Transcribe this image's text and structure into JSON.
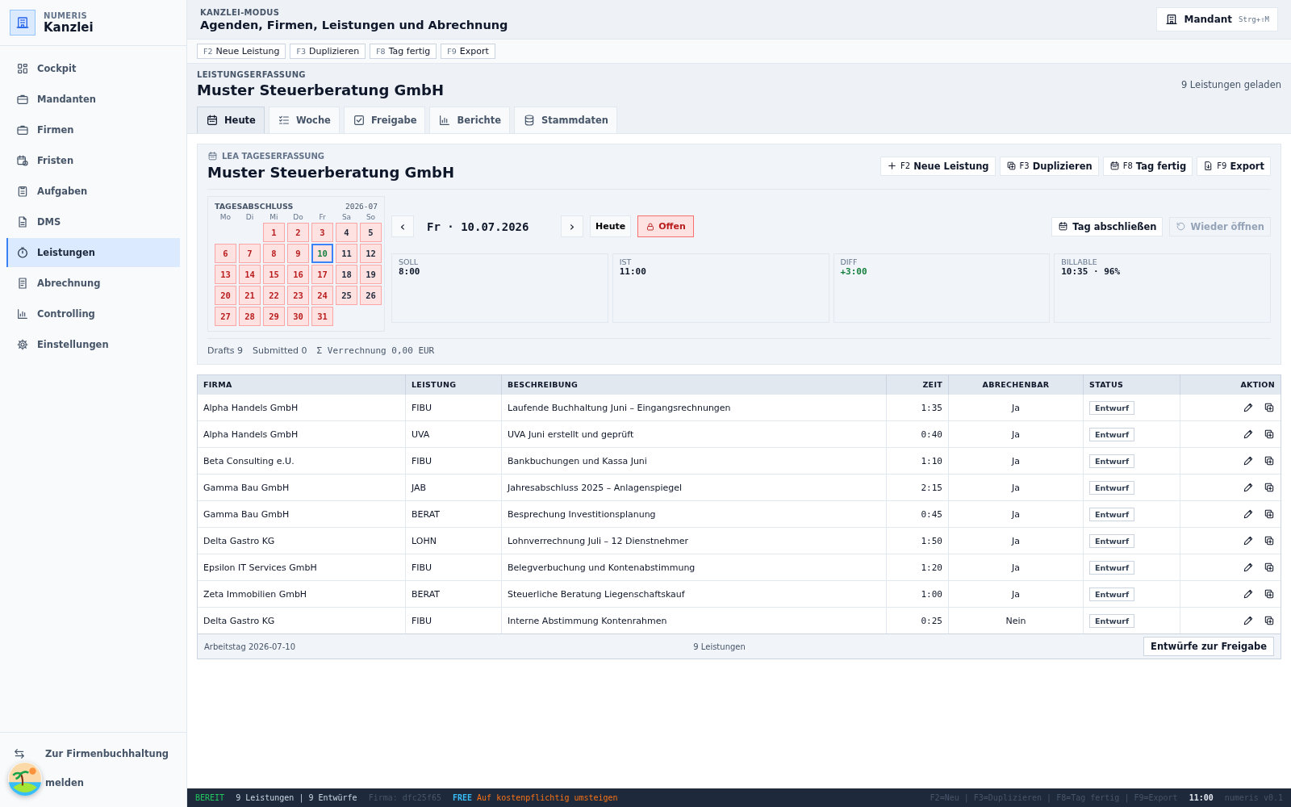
{
  "brand": {
    "overline": "NUMERIS",
    "title": "Kanzlei"
  },
  "sidebar": {
    "items": [
      {
        "label": "Cockpit",
        "selected": false
      },
      {
        "label": "Mandanten",
        "selected": false
      },
      {
        "label": "Firmen",
        "selected": false
      },
      {
        "label": "Fristen",
        "selected": false
      },
      {
        "label": "Aufgaben",
        "selected": false
      },
      {
        "label": "DMS",
        "selected": false
      },
      {
        "label": "Leistungen",
        "selected": true
      },
      {
        "label": "Abrechnung",
        "selected": false
      },
      {
        "label": "Controlling",
        "selected": false
      },
      {
        "label": "Einstellungen",
        "selected": false
      }
    ],
    "footer": [
      {
        "label": "Zur Firmenbuchhaltung"
      },
      {
        "label": "melden"
      }
    ]
  },
  "header": {
    "overline": "KANZLEI-MODUS",
    "title": "Agenden, Firmen, Leistungen und Abrechnung",
    "mandant_button": {
      "label": "Mandant",
      "shortcut": "Strg+⇧M"
    }
  },
  "toolbar": [
    {
      "key": "F2",
      "label": "Neue Leistung"
    },
    {
      "key": "F3",
      "label": "Duplizieren"
    },
    {
      "key": "F8",
      "label": "Tag fertig"
    },
    {
      "key": "F9",
      "label": "Export"
    }
  ],
  "section": {
    "overline": "LEISTUNGSERFASSUNG",
    "title": "Muster Steuerberatung GmbH",
    "info": "9 Leistungen geladen"
  },
  "tabs": [
    {
      "label": "Heute",
      "selected": true
    },
    {
      "label": "Woche",
      "selected": false
    },
    {
      "label": "Freigabe",
      "selected": false
    },
    {
      "label": "Berichte",
      "selected": false
    },
    {
      "label": "Stammdaten",
      "selected": false
    }
  ],
  "card": {
    "overline": "LEA TAGESERFASSUNG",
    "title": "Muster Steuerberatung GmbH",
    "actions": [
      {
        "key": "F2",
        "label": "Neue Leistung"
      },
      {
        "key": "F3",
        "label": "Duplizieren"
      },
      {
        "key": "F8",
        "label": "Tag fertig"
      },
      {
        "key": "F9",
        "label": "Export"
      }
    ],
    "calendar": {
      "title": "TAGESABSCHLUSS",
      "month": "2026-07",
      "weekdays": [
        "Mo",
        "Di",
        "Mi",
        "Do",
        "Fr",
        "Sa",
        "So"
      ],
      "days": [
        {
          "label": "1",
          "kind": "workday",
          "selected": false
        },
        {
          "label": "2",
          "kind": "workday",
          "selected": false
        },
        {
          "label": "3",
          "kind": "workday",
          "selected": false
        },
        {
          "label": "4",
          "kind": "weekend",
          "selected": false
        },
        {
          "label": "5",
          "kind": "weekend",
          "selected": false
        },
        {
          "label": "6",
          "kind": "workday",
          "selected": false
        },
        {
          "label": "7",
          "kind": "workday",
          "selected": false
        },
        {
          "label": "8",
          "kind": "workday",
          "selected": false
        },
        {
          "label": "9",
          "kind": "workday",
          "selected": false
        },
        {
          "label": "10",
          "kind": "workday",
          "selected": true
        },
        {
          "label": "11",
          "kind": "weekend",
          "selected": false
        },
        {
          "label": "12",
          "kind": "weekend",
          "selected": false
        },
        {
          "label": "13",
          "kind": "workday",
          "selected": false
        },
        {
          "label": "14",
          "kind": "workday",
          "selected": false
        },
        {
          "label": "15",
          "kind": "workday",
          "selected": false
        },
        {
          "label": "16",
          "kind": "workday",
          "selected": false
        },
        {
          "label": "17",
          "kind": "workday",
          "selected": false
        },
        {
          "label": "18",
          "kind": "weekend",
          "selected": false
        },
        {
          "label": "19",
          "kind": "weekend",
          "selected": false
        },
        {
          "label": "20",
          "kind": "workday",
          "selected": false
        },
        {
          "label": "21",
          "kind": "workday",
          "selected": false
        },
        {
          "label": "22",
          "kind": "workday",
          "selected": false
        },
        {
          "label": "23",
          "kind": "workday",
          "selected": false
        },
        {
          "label": "24",
          "kind": "workday",
          "selected": false
        },
        {
          "label": "25",
          "kind": "weekend",
          "selected": false
        },
        {
          "label": "26",
          "kind": "weekend",
          "selected": false
        },
        {
          "label": "27",
          "kind": "workday",
          "selected": false
        },
        {
          "label": "28",
          "kind": "workday",
          "selected": false
        },
        {
          "label": "29",
          "kind": "workday",
          "selected": false
        },
        {
          "label": "30",
          "kind": "workday",
          "selected": false
        },
        {
          "label": "31",
          "kind": "workday",
          "selected": false
        }
      ]
    },
    "date_nav": {
      "prev": "‹",
      "date": "Fr · 10.07.2026",
      "next": "›",
      "today": "Heute",
      "status": "Offen",
      "close_day": "Tag abschließen",
      "reopen": {
        "label": "Wieder öffnen",
        "disabled": true
      }
    },
    "stats": [
      {
        "label": "SOLL",
        "value": "8:00",
        "kind": "plain"
      },
      {
        "label": "IST",
        "value": "11:00",
        "kind": "plain"
      },
      {
        "label": "DIFF",
        "value": "+3:00",
        "kind": "positive"
      },
      {
        "label": "BILLABLE",
        "value": "10:35 · 96%",
        "kind": "plain"
      }
    ],
    "summary": [
      {
        "text": "Drafts 9",
        "kind": "plain"
      },
      {
        "text": "Submitted 0",
        "kind": "plain"
      },
      {
        "text": "Σ Verrechnung 0,00 EUR",
        "kind": "mono"
      }
    ]
  },
  "table": {
    "columns": [
      "FIRMA",
      "LEISTUNG",
      "BESCHREIBUNG",
      "ZEIT",
      "ABRECHENBAR",
      "STATUS",
      "AKTION"
    ],
    "rows": [
      [
        "Alpha Handels GmbH",
        "FIBU",
        "Laufende Buchhaltung Juni – Eingangsrechnungen",
        "1:35",
        "Ja",
        "Entwurf"
      ],
      [
        "Alpha Handels GmbH",
        "UVA",
        "UVA Juni erstellt und geprüft",
        "0:40",
        "Ja",
        "Entwurf"
      ],
      [
        "Beta Consulting e.U.",
        "FIBU",
        "Bankbuchungen und Kassa Juni",
        "1:10",
        "Ja",
        "Entwurf"
      ],
      [
        "Gamma Bau GmbH",
        "JAB",
        "Jahresabschluss 2025 – Anlagenspiegel",
        "2:15",
        "Ja",
        "Entwurf"
      ],
      [
        "Gamma Bau GmbH",
        "BERAT",
        "Besprechung Investitionsplanung",
        "0:45",
        "Ja",
        "Entwurf"
      ],
      [
        "Delta Gastro KG",
        "LOHN",
        "Lohnverrechnung Juli – 12 Dienstnehmer",
        "1:50",
        "Ja",
        "Entwurf"
      ],
      [
        "Epsilon IT Services GmbH",
        "FIBU",
        "Belegverbuchung und Kontenabstimmung",
        "1:20",
        "Ja",
        "Entwurf"
      ],
      [
        "Zeta Immobilien GmbH",
        "BERAT",
        "Steuerliche Beratung Liegenschaftskauf",
        "1:00",
        "Ja",
        "Entwurf"
      ],
      [
        "Delta Gastro KG",
        "FIBU",
        "Interne Abstimmung Kontenrahmen",
        "0:25",
        "Nein",
        "Entwurf"
      ]
    ],
    "footer": {
      "left": "Arbeitstag 2026-07-10",
      "center": "9 Leistungen",
      "button": "Entwürfe zur Freigabe"
    }
  },
  "status_bar": [
    {
      "text": "BEREIT",
      "kind": "ok"
    },
    {
      "text": "9 Leistungen | 9 Entwürfe",
      "kind": "info"
    },
    {
      "text": "Firma: dfc25f65",
      "kind": "dim"
    },
    {
      "text": "FREE",
      "kind": "accent"
    },
    {
      "text": "Auf kostenpflichtig umsteigen",
      "kind": "link"
    },
    {
      "text": "F2=Neu | F3=Duplizieren | F8=Tag fertig | F9=Export",
      "kind": "hint"
    },
    {
      "text": "11:00",
      "kind": "clock"
    },
    {
      "text": "numeris v0.1",
      "kind": "dim"
    }
  ]
}
